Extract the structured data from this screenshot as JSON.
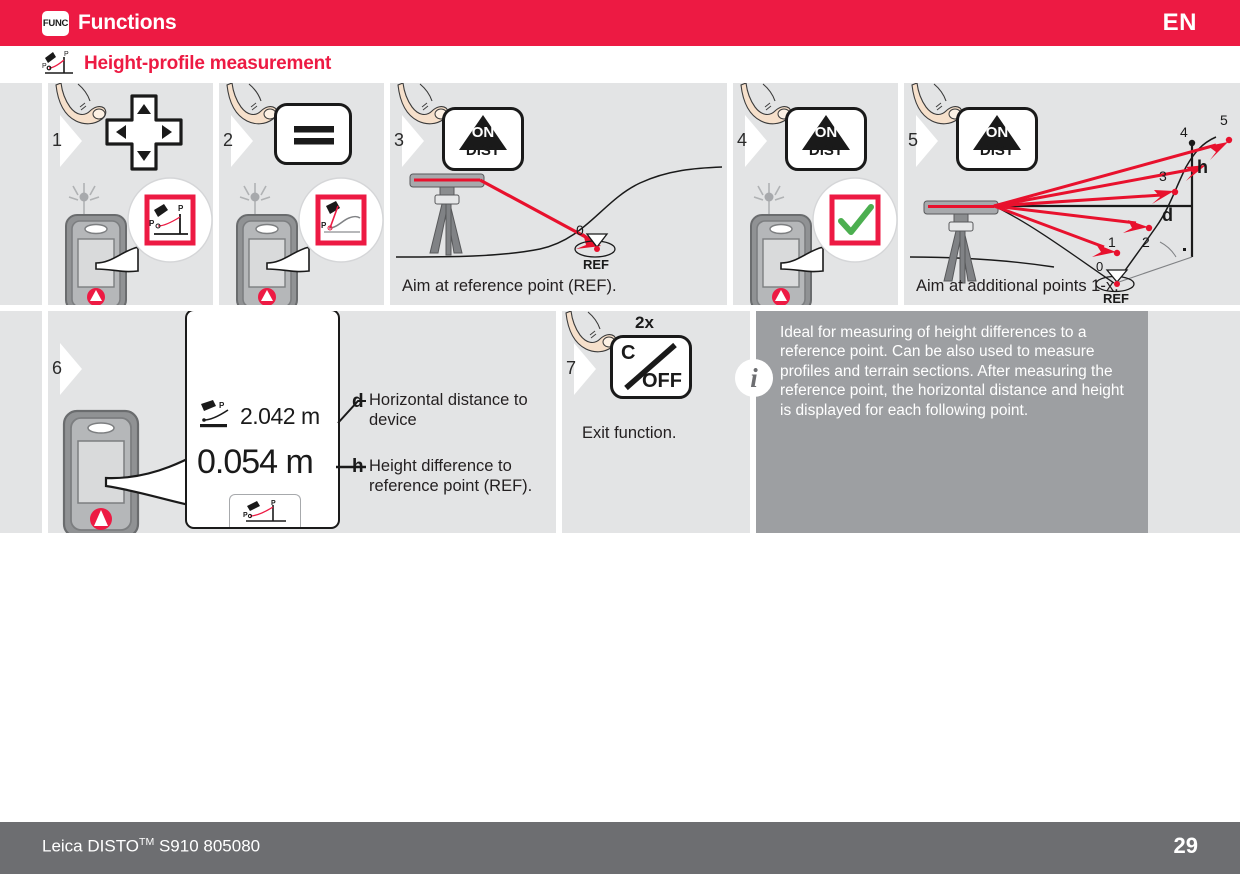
{
  "header": {
    "func_badge": "FUNC",
    "title": "Functions",
    "language": "EN",
    "accent_color": "#ed1a43"
  },
  "subtitle": {
    "icon": "height-profile-icon",
    "text": "Height-profile measurement"
  },
  "steps": [
    {
      "num": "1",
      "icon": "navigation-pad-key",
      "key_label": "",
      "caption": "",
      "screen": "height-profile-function-icon"
    },
    {
      "num": "2",
      "icon": "equals-key",
      "key_label": "=",
      "caption": "",
      "screen": "profile-curve-icon"
    },
    {
      "num": "3",
      "icon": "on-dist-key",
      "key_label_top": "ON",
      "key_label_bottom": "DIST",
      "caption": "Aim at reference point (REF).",
      "diagram_labels": [
        "0",
        "REF"
      ]
    },
    {
      "num": "4",
      "icon": "on-dist-key",
      "key_label_top": "ON",
      "key_label_bottom": "DIST",
      "caption": "",
      "screen": "green-checkmark"
    },
    {
      "num": "5",
      "icon": "on-dist-key",
      "key_label_top": "ON",
      "key_label_bottom": "DIST",
      "caption": "Aim at additional points 1-x.",
      "diagram_labels": [
        "0",
        "1",
        "2",
        "3",
        "4",
        "5",
        "h",
        "d",
        "REF"
      ]
    },
    {
      "num": "6",
      "caption": "",
      "display": {
        "value_top": "2.042 m",
        "value_bottom": "0.054 m",
        "icon_top": "horizontal-distance-icon",
        "icon_bottom": "height-profile-function-icon"
      },
      "legend": [
        {
          "symbol": "d",
          "text": "Horizontal distance to device"
        },
        {
          "symbol": "h",
          "text": "Height difference to reference point (REF)."
        }
      ]
    },
    {
      "num": "7",
      "icon": "clear-off-key",
      "press_count": "2x",
      "key_label_top": "C",
      "key_label_bottom": "OFF",
      "caption": "Exit function."
    }
  ],
  "info": {
    "icon": "info-icon",
    "text": "Ideal for measuring of height differences to a reference point. Can be also used to measure profiles and terrain sections. After measuring the reference point, the horizontal distance and height is displayed for each following point."
  },
  "footer": {
    "product": "Leica DISTO",
    "product_tm": "TM",
    "product_rest": " S910 805080",
    "page": "29",
    "background_color": "#6d6e71"
  }
}
